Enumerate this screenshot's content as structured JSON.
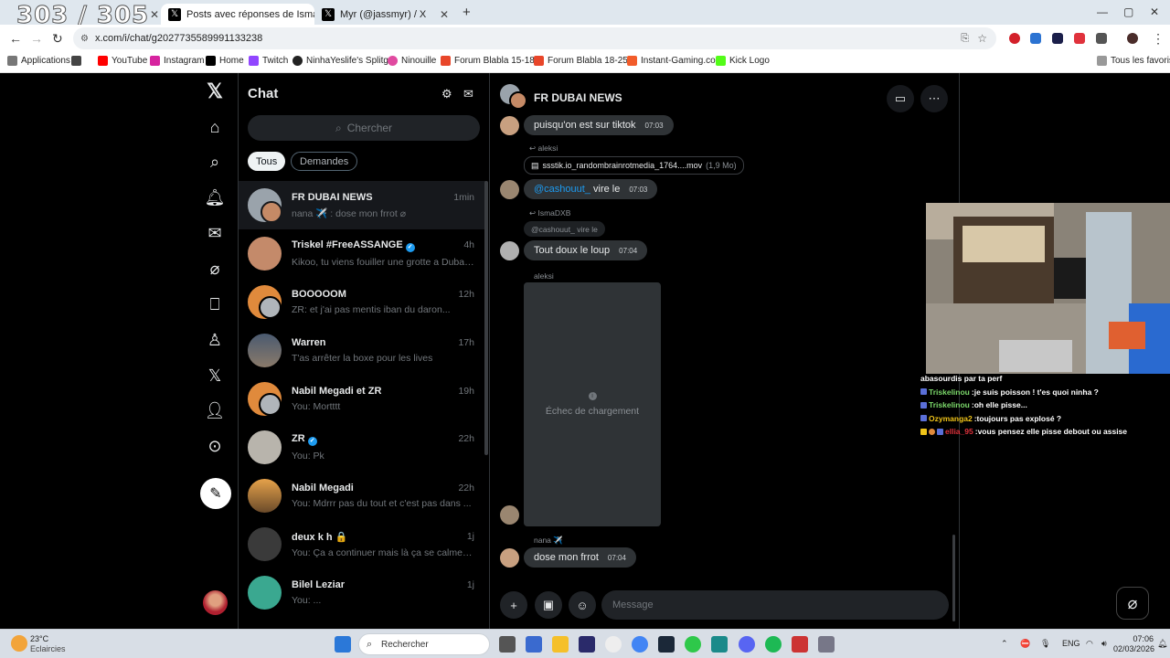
{
  "browser": {
    "overlay_counter": "303 / 305",
    "tabs": [
      {
        "label": "Posts avec réponses de IsmaDX",
        "active": true
      },
      {
        "label": "Myr (@jassmyr) / X",
        "active": false
      }
    ],
    "url": "x.com/i/chat/g2027735589991133238",
    "bookmarks": [
      "Applications",
      "YouTube",
      "Instagram",
      "Home",
      "Twitch",
      "NinhaYeslife's Splitg...",
      "Ninouille",
      "Forum Blabla 15-18...",
      "Forum Blabla 18-25...",
      "Instant-Gaming.com",
      "Kick Logo"
    ],
    "all_bookmarks": "Tous les favoris"
  },
  "chatlist": {
    "title": "Chat",
    "search_placeholder": "Chercher",
    "filters": {
      "all": "Tous",
      "requests": "Demandes"
    },
    "conversations": [
      {
        "name": "FR DUBAI NEWS",
        "time": "1min",
        "preview": "nana ✈️ : dose mon frrot ⌀",
        "selected": true,
        "verified": false
      },
      {
        "name": "Triskel #FreeASSANGE",
        "time": "4h",
        "preview": "Kikoo, tu viens fouiller une grotte a Dubaï ...",
        "selected": false,
        "verified": true
      },
      {
        "name": "BOOOOOM",
        "time": "12h",
        "preview": "ZR: et j'ai pas mentis iban du daron...",
        "selected": false,
        "verified": false
      },
      {
        "name": "Warren",
        "time": "17h",
        "preview": "T'as arrêter la boxe pour les lives",
        "selected": false,
        "verified": false
      },
      {
        "name": "Nabil Megadi et ZR",
        "time": "19h",
        "preview": "You: Mortttt",
        "selected": false,
        "verified": false
      },
      {
        "name": "ZR",
        "time": "22h",
        "preview": "You: Pk",
        "selected": false,
        "verified": true
      },
      {
        "name": "Nabil Megadi",
        "time": "22h",
        "preview": "You: Mdrrr pas du tout et c'est pas dans ...",
        "selected": false,
        "verified": false
      },
      {
        "name": "deux k h 🔒",
        "time": "1j",
        "preview": "You: Ça a continuer mais là ça se calme o...",
        "selected": false,
        "verified": false
      },
      {
        "name": "Bilel Leziar",
        "time": "1j",
        "preview": "You: ...",
        "selected": false,
        "verified": false
      }
    ]
  },
  "conversation": {
    "name": "FR DUBAI NEWS",
    "messages": {
      "m1": {
        "text": "puisqu'on est sur tiktok",
        "time": "07:03"
      },
      "r1_author": "aleksi",
      "file": {
        "name": "ssstik.io_randombrainrotmedia_1764....mov",
        "size": "(1,9 Mo)"
      },
      "m2": {
        "mention": "@cashouut_",
        "text": "vire le",
        "time": "07:03"
      },
      "r2_author": "IsmaDXB",
      "quote": "@cashouut_ vire le",
      "m3": {
        "text": "Tout doux le loup",
        "time": "07:04"
      },
      "media_author": "aleksi",
      "media_error": "Échec de chargement",
      "last_author": "nana ✈️",
      "m4": {
        "text": "dose mon frrot",
        "time": "07:04"
      }
    },
    "composer_placeholder": "Message"
  },
  "stream_chat": [
    {
      "user": "",
      "text": "abasourdis par ta perf",
      "color": "#ffffff"
    },
    {
      "user": "Triskelinou",
      "text": ":je suis poisson ! t'es quoi ninha ?",
      "color": "#7bd86a"
    },
    {
      "user": "Triskelinou",
      "text": ":oh elle pisse...",
      "color": "#7bd86a"
    },
    {
      "user": "Ozymanga2",
      "text": ":toujours pas explosé ?",
      "color": "#f0c419"
    },
    {
      "user": "ellia_95",
      "text": ":vous pensez elle pisse debout ou assise",
      "color": "#e0323c"
    }
  ],
  "taskbar": {
    "weather_temp": "23°C",
    "weather_desc": "Eclaircies",
    "search": "Rechercher",
    "lang": "ENG",
    "time": "07:06",
    "date": "02/03/2026"
  }
}
